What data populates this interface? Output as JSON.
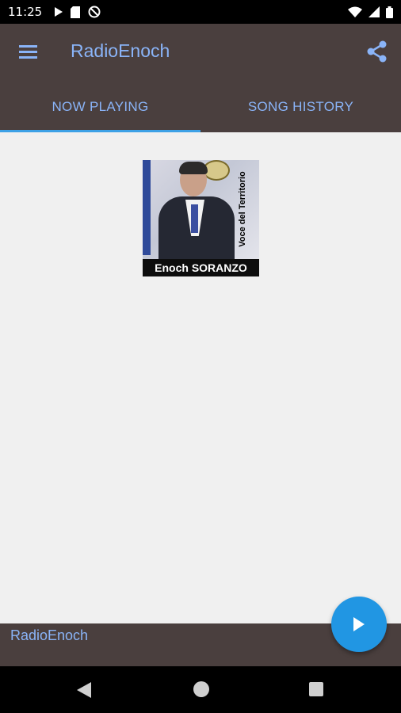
{
  "status_bar": {
    "time": "11:25",
    "icons_left": [
      "play-icon",
      "sd-card-icon",
      "no-sync-icon"
    ],
    "icons_right": [
      "wifi-icon",
      "signal-icon",
      "battery-icon"
    ]
  },
  "app_bar": {
    "title": "RadioEnoch",
    "menu_icon": "menu-icon",
    "share_icon": "share-icon"
  },
  "tabs": [
    {
      "label": "NOW PLAYING",
      "selected": true
    },
    {
      "label": "SONG HISTORY",
      "selected": false
    }
  ],
  "now_playing": {
    "album_art": {
      "banner_text": "Enoch SORANZO",
      "side_text": "Voce del Territorio"
    }
  },
  "bottom_bar": {
    "station_name": "RadioEnoch"
  },
  "fab": {
    "icon": "play-icon"
  },
  "colors": {
    "app_bar": "#4a3f3e",
    "accent_text": "#8ab4f8",
    "tab_indicator": "#3da1e6",
    "fab": "#2196e3",
    "content_bg": "#f0f0f0"
  }
}
